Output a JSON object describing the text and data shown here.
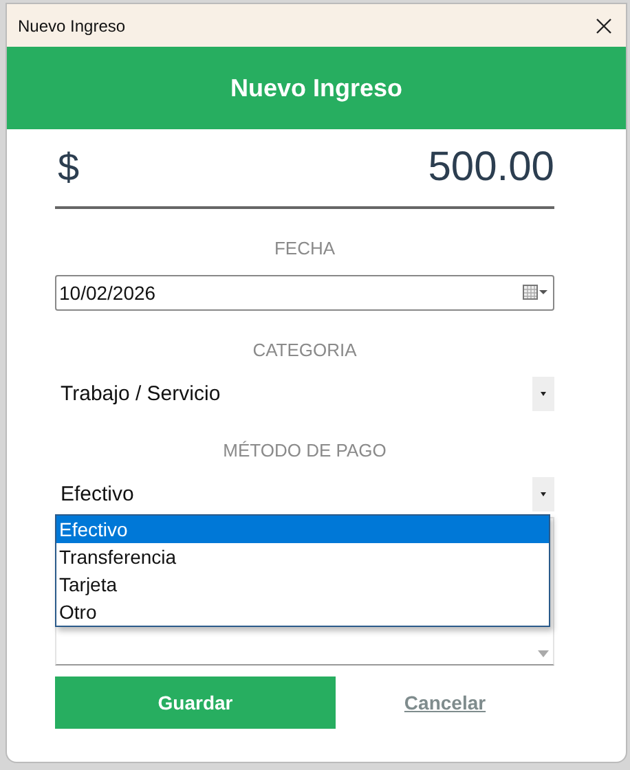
{
  "window": {
    "title": "Nuevo Ingreso"
  },
  "header": {
    "title": "Nuevo Ingreso"
  },
  "amount": {
    "currency": "$",
    "value": "500.00"
  },
  "fields": [
    {
      "kind": "date",
      "label": "FECHA",
      "value": "10/02/2026"
    },
    {
      "kind": "combo",
      "label": "CATEGORIA",
      "value": "Trabajo / Servicio"
    },
    {
      "kind": "combo",
      "label": "MÉTODO DE PAGO",
      "value": "Efectivo",
      "options": [
        {
          "label": "Efectivo",
          "selected": true
        },
        {
          "label": "Transferencia",
          "selected": false
        },
        {
          "label": "Tarjeta",
          "selected": false
        },
        {
          "label": "Otro",
          "selected": false
        }
      ]
    }
  ],
  "buttons": [
    {
      "kind": "primary",
      "label": "Guardar"
    },
    {
      "kind": "link",
      "label": "Cancelar"
    }
  ]
}
